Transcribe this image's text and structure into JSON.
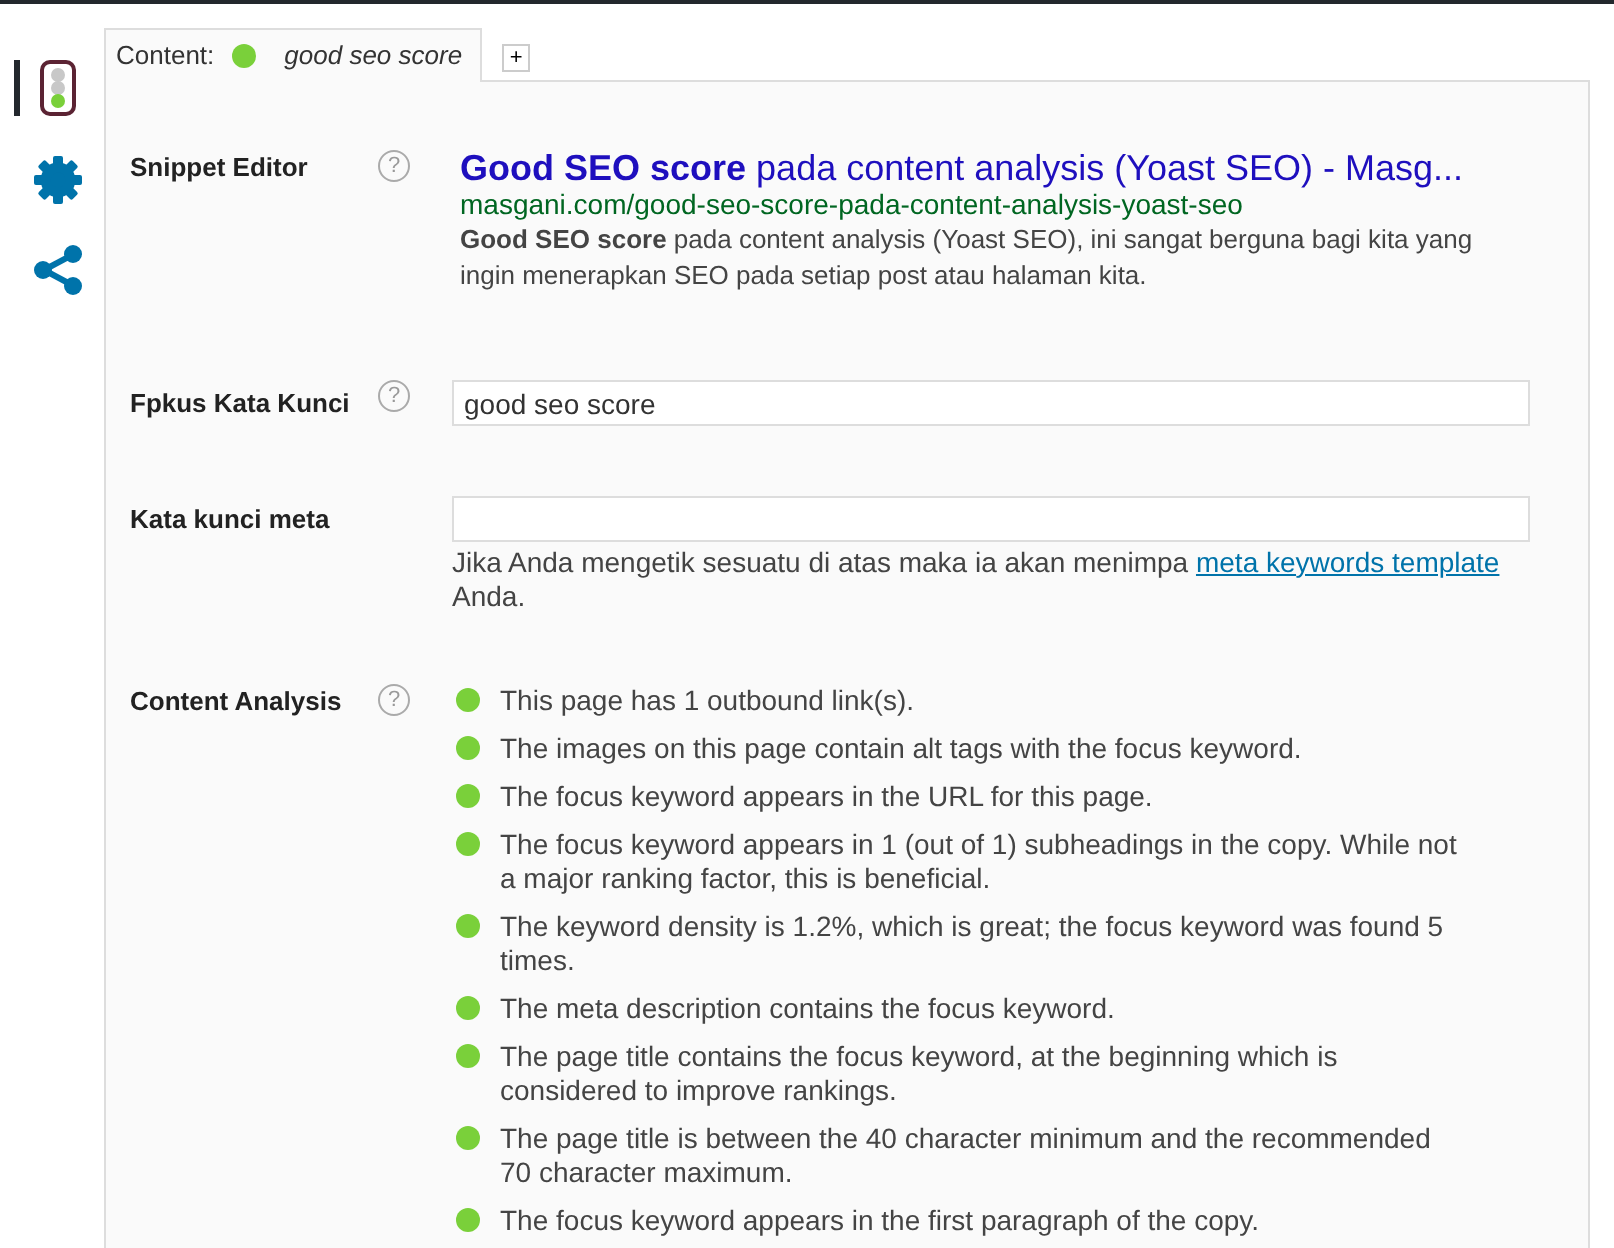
{
  "sidebar": {
    "items": [
      {
        "kind": "analysis",
        "selected": true
      },
      {
        "kind": "settings",
        "selected": false
      },
      {
        "kind": "share",
        "selected": false
      }
    ]
  },
  "tabs": [
    {
      "label": "Content:",
      "color": "#7ad03a",
      "keyword": "good seo score",
      "selected": true
    }
  ],
  "add_tab": {
    "label": "+"
  },
  "fields": [
    {
      "kind": "snippet",
      "label": "Snippet Editor",
      "help": "?",
      "title": "**Good SEO score** pada content analysis (Yoast SEO) - Masg...",
      "url": "masgani.com/good-seo-score-pada-content-analysis-yoast-seo",
      "description": "**Good SEO score** pada content analysis (Yoast SEO), ini sangat berguna bagi kita yang ingin menerapkan SEO pada setiap post atau halaman kita."
    },
    {
      "kind": "input",
      "label": "Fpkus Kata Kunci",
      "help": "?",
      "value": "good seo score"
    },
    {
      "kind": "input",
      "label": "Kata kunci meta",
      "hint": {
        "text": "Jika Anda mengetik sesuatu di atas maka ia akan menimpa ",
        "link": "meta keywords template",
        "text_after": " Anda."
      }
    },
    {
      "kind": "analysis",
      "label": "Content Analysis",
      "help": "?",
      "results": [
        {
          "text": "This page has 1 outbound link(s).",
          "color": "#7ad03a"
        },
        {
          "text": "The images on this page contain alt tags with the focus keyword.",
          "color": "#7ad03a"
        },
        {
          "text": "The focus keyword appears in the URL for this page.",
          "color": "#7ad03a"
        },
        {
          "text": "The focus keyword appears in 1 (out of 1) subheadings in the copy. While not a major ranking factor, this is beneficial.",
          "color": "#7ad03a"
        },
        {
          "text": "The keyword density is 1.2%, which is great; the focus keyword was found 5 times.",
          "color": "#7ad03a"
        },
        {
          "text": "The meta description contains the focus keyword.",
          "color": "#7ad03a"
        },
        {
          "text": "The page title contains the focus keyword, at the beginning which is considered to improve rankings.",
          "color": "#7ad03a"
        },
        {
          "text": "The page title is between the 40 character minimum and the recommended 70 character maximum.",
          "color": "#7ad03a"
        },
        {
          "text": "The focus keyword appears in the first paragraph of the copy.",
          "color": "#7ad03a"
        }
      ]
    }
  ]
}
